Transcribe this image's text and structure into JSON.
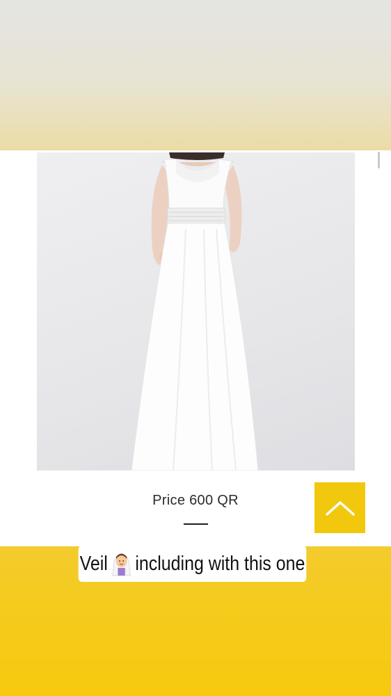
{
  "product": {
    "price_text": "Price 600 QR",
    "image_alt": "White lace bridal gown"
  },
  "caption": {
    "prefix": "Veil",
    "emoji_icon": "bride-with-veil-icon",
    "suffix": "including with this one"
  },
  "back_to_top": {
    "icon": "chevron-up-icon",
    "color": "#f2c80e"
  },
  "colors": {
    "top_band": "#e8e4d3",
    "bottom_band": "#f5cb1d"
  }
}
